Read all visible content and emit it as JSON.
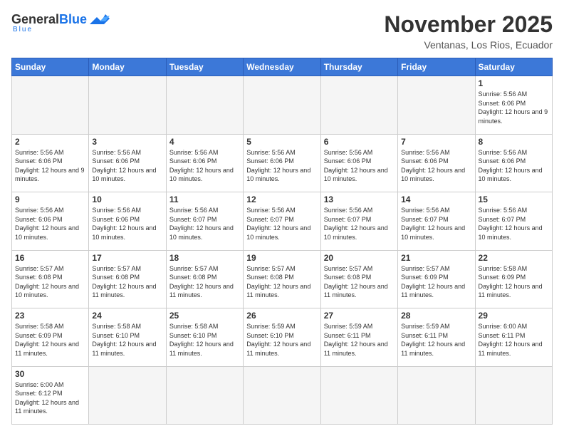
{
  "logo": {
    "general": "General",
    "blue": "Blue",
    "tagline": "Blue"
  },
  "header": {
    "title": "November 2025",
    "subtitle": "Ventanas, Los Rios, Ecuador"
  },
  "weekdays": [
    "Sunday",
    "Monday",
    "Tuesday",
    "Wednesday",
    "Thursday",
    "Friday",
    "Saturday"
  ],
  "weeks": [
    [
      {
        "day": "",
        "info": ""
      },
      {
        "day": "",
        "info": ""
      },
      {
        "day": "",
        "info": ""
      },
      {
        "day": "",
        "info": ""
      },
      {
        "day": "",
        "info": ""
      },
      {
        "day": "",
        "info": ""
      },
      {
        "day": "1",
        "info": "Sunrise: 5:56 AM\nSunset: 6:06 PM\nDaylight: 12 hours and 9 minutes."
      }
    ],
    [
      {
        "day": "2",
        "info": "Sunrise: 5:56 AM\nSunset: 6:06 PM\nDaylight: 12 hours and 9 minutes."
      },
      {
        "day": "3",
        "info": "Sunrise: 5:56 AM\nSunset: 6:06 PM\nDaylight: 12 hours and 10 minutes."
      },
      {
        "day": "4",
        "info": "Sunrise: 5:56 AM\nSunset: 6:06 PM\nDaylight: 12 hours and 10 minutes."
      },
      {
        "day": "5",
        "info": "Sunrise: 5:56 AM\nSunset: 6:06 PM\nDaylight: 12 hours and 10 minutes."
      },
      {
        "day": "6",
        "info": "Sunrise: 5:56 AM\nSunset: 6:06 PM\nDaylight: 12 hours and 10 minutes."
      },
      {
        "day": "7",
        "info": "Sunrise: 5:56 AM\nSunset: 6:06 PM\nDaylight: 12 hours and 10 minutes."
      },
      {
        "day": "8",
        "info": "Sunrise: 5:56 AM\nSunset: 6:06 PM\nDaylight: 12 hours and 10 minutes."
      }
    ],
    [
      {
        "day": "9",
        "info": "Sunrise: 5:56 AM\nSunset: 6:06 PM\nDaylight: 12 hours and 10 minutes."
      },
      {
        "day": "10",
        "info": "Sunrise: 5:56 AM\nSunset: 6:06 PM\nDaylight: 12 hours and 10 minutes."
      },
      {
        "day": "11",
        "info": "Sunrise: 5:56 AM\nSunset: 6:07 PM\nDaylight: 12 hours and 10 minutes."
      },
      {
        "day": "12",
        "info": "Sunrise: 5:56 AM\nSunset: 6:07 PM\nDaylight: 12 hours and 10 minutes."
      },
      {
        "day": "13",
        "info": "Sunrise: 5:56 AM\nSunset: 6:07 PM\nDaylight: 12 hours and 10 minutes."
      },
      {
        "day": "14",
        "info": "Sunrise: 5:56 AM\nSunset: 6:07 PM\nDaylight: 12 hours and 10 minutes."
      },
      {
        "day": "15",
        "info": "Sunrise: 5:56 AM\nSunset: 6:07 PM\nDaylight: 12 hours and 10 minutes."
      }
    ],
    [
      {
        "day": "16",
        "info": "Sunrise: 5:57 AM\nSunset: 6:08 PM\nDaylight: 12 hours and 10 minutes."
      },
      {
        "day": "17",
        "info": "Sunrise: 5:57 AM\nSunset: 6:08 PM\nDaylight: 12 hours and 11 minutes."
      },
      {
        "day": "18",
        "info": "Sunrise: 5:57 AM\nSunset: 6:08 PM\nDaylight: 12 hours and 11 minutes."
      },
      {
        "day": "19",
        "info": "Sunrise: 5:57 AM\nSunset: 6:08 PM\nDaylight: 12 hours and 11 minutes."
      },
      {
        "day": "20",
        "info": "Sunrise: 5:57 AM\nSunset: 6:08 PM\nDaylight: 12 hours and 11 minutes."
      },
      {
        "day": "21",
        "info": "Sunrise: 5:57 AM\nSunset: 6:09 PM\nDaylight: 12 hours and 11 minutes."
      },
      {
        "day": "22",
        "info": "Sunrise: 5:58 AM\nSunset: 6:09 PM\nDaylight: 12 hours and 11 minutes."
      }
    ],
    [
      {
        "day": "23",
        "info": "Sunrise: 5:58 AM\nSunset: 6:09 PM\nDaylight: 12 hours and 11 minutes."
      },
      {
        "day": "24",
        "info": "Sunrise: 5:58 AM\nSunset: 6:10 PM\nDaylight: 12 hours and 11 minutes."
      },
      {
        "day": "25",
        "info": "Sunrise: 5:58 AM\nSunset: 6:10 PM\nDaylight: 12 hours and 11 minutes."
      },
      {
        "day": "26",
        "info": "Sunrise: 5:59 AM\nSunset: 6:10 PM\nDaylight: 12 hours and 11 minutes."
      },
      {
        "day": "27",
        "info": "Sunrise: 5:59 AM\nSunset: 6:11 PM\nDaylight: 12 hours and 11 minutes."
      },
      {
        "day": "28",
        "info": "Sunrise: 5:59 AM\nSunset: 6:11 PM\nDaylight: 12 hours and 11 minutes."
      },
      {
        "day": "29",
        "info": "Sunrise: 6:00 AM\nSunset: 6:11 PM\nDaylight: 12 hours and 11 minutes."
      }
    ],
    [
      {
        "day": "30",
        "info": "Sunrise: 6:00 AM\nSunset: 6:12 PM\nDaylight: 12 hours and 11 minutes."
      },
      {
        "day": "",
        "info": ""
      },
      {
        "day": "",
        "info": ""
      },
      {
        "day": "",
        "info": ""
      },
      {
        "day": "",
        "info": ""
      },
      {
        "day": "",
        "info": ""
      },
      {
        "day": "",
        "info": ""
      }
    ]
  ]
}
